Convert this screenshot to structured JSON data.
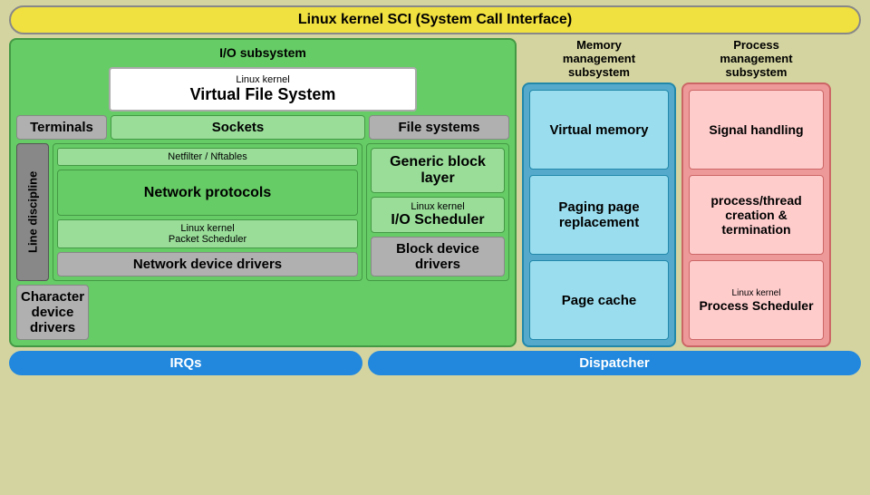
{
  "sci_bar": {
    "text": "Linux kernel SCI (System Call Interface)"
  },
  "io_subsystem": {
    "header": "I/O subsystem",
    "vfs": {
      "small": "Linux kernel",
      "big": "Virtual File System"
    },
    "terminals": "Terminals",
    "sockets": "Sockets",
    "filesystems": "File systems",
    "line_discipline": "Line discipline",
    "netfilter": "Netfilter / Nftables",
    "network_protocols": "Network protocols",
    "packet_scheduler_small": "Linux kernel",
    "packet_scheduler_big": "Packet Scheduler",
    "network_device_drivers": "Network device drivers",
    "generic_block_layer": "Generic block layer",
    "io_scheduler_small": "Linux kernel",
    "io_scheduler_big": "I/O Scheduler",
    "block_device_drivers": "Block device drivers",
    "char_device_drivers": "Character device drivers"
  },
  "memory": {
    "header_line1": "Memory",
    "header_line2": "management",
    "header_line3": "subsystem",
    "virtual_memory": "Virtual memory",
    "paging": "Paging page replacement",
    "page_cache": "Page cache"
  },
  "process": {
    "header_line1": "Process",
    "header_line2": "management",
    "header_line3": "subsystem",
    "signal_handling": "Signal handling",
    "thread_creation": "process/thread creation & termination",
    "scheduler_small": "Linux kernel",
    "scheduler_big": "Process Scheduler"
  },
  "bottom": {
    "irqs": "IRQs",
    "dispatcher": "Dispatcher"
  }
}
